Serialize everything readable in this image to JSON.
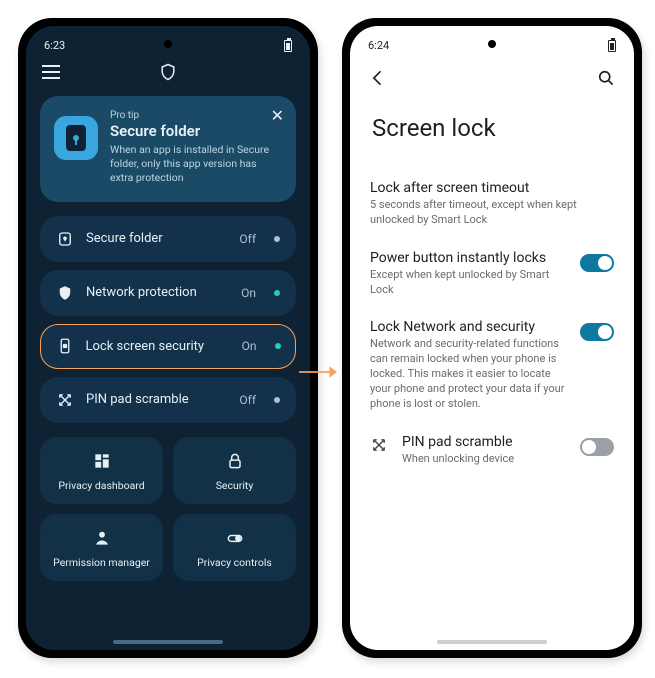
{
  "left": {
    "time": "6:23",
    "tip": {
      "eyebrow": "Pro tip",
      "title": "Secure folder",
      "desc": "When an app is installed in Secure folder, only this app version has extra protection"
    },
    "rows": [
      {
        "icon": "secure-folder-icon",
        "label": "Secure folder",
        "status": "Off",
        "on": false,
        "highlight": false
      },
      {
        "icon": "shield-icon",
        "label": "Network protection",
        "status": "On",
        "on": true,
        "highlight": false
      },
      {
        "icon": "phone-lock-icon",
        "label": "Lock screen security",
        "status": "On",
        "on": true,
        "highlight": true
      },
      {
        "icon": "scramble-icon",
        "label": "PIN pad scramble",
        "status": "Off",
        "on": false,
        "highlight": false
      }
    ],
    "tiles": [
      {
        "icon": "dashboard-icon",
        "label": "Privacy dashboard"
      },
      {
        "icon": "lock-icon",
        "label": "Security"
      },
      {
        "icon": "person-icon",
        "label": "Permission manager"
      },
      {
        "icon": "toggles-icon",
        "label": "Privacy controls"
      }
    ]
  },
  "right": {
    "time": "6:24",
    "title": "Screen lock",
    "settings": [
      {
        "title": "Lock after screen timeout",
        "sub": "5 seconds after timeout, except when kept unlocked by Smart Lock",
        "toggle": null,
        "leading": null
      },
      {
        "title": "Power button instantly locks",
        "sub": "Except when kept unlocked by Smart Lock",
        "toggle": true,
        "leading": null
      },
      {
        "title": "Lock Network and security",
        "sub": "Network and security-related functions can remain locked when your phone is locked. This makes it easier to locate your phone and protect your data if your phone is lost or stolen.",
        "toggle": true,
        "leading": null
      },
      {
        "title": "PIN pad scramble",
        "sub": "When unlocking device",
        "toggle": false,
        "leading": "scramble-icon"
      }
    ]
  }
}
